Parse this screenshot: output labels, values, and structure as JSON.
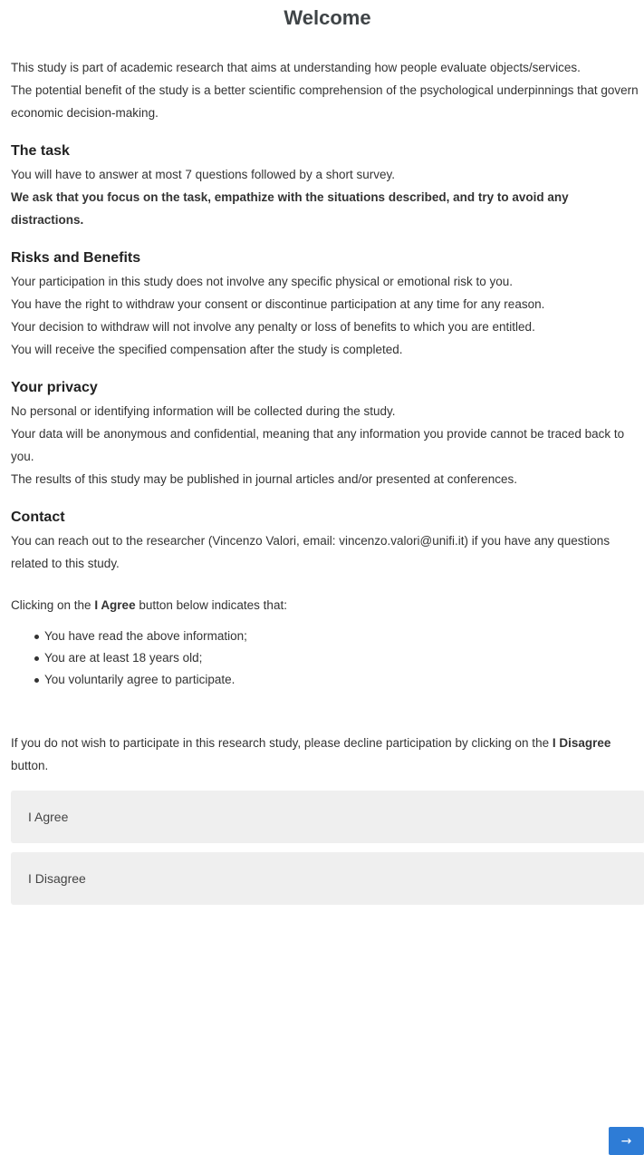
{
  "title": "Welcome",
  "intro": {
    "line1": "This study is part of academic research that aims at understanding how people evaluate objects/services.",
    "line2": "The potential benefit of the study is a better scientific comprehension of the psychological underpinnings that govern economic decision-making."
  },
  "task": {
    "heading": "The task",
    "line1": "You will have to answer at most 7 questions followed by a short survey.",
    "line2_bold": "We ask that you focus on the task, empathize with the situations described, and try to avoid any distractions."
  },
  "risks": {
    "heading": "Risks and Benefits",
    "lines": [
      "Your participation in this study does not involve any specific physical or emotional risk to you.",
      "You have the right to withdraw your consent or discontinue participation at any time for any reason.",
      "Your decision to withdraw will not involve any penalty or loss of benefits to which you are entitled.",
      "You will receive the specified compensation after the study is completed."
    ]
  },
  "privacy": {
    "heading": "Your privacy",
    "lines": [
      "No personal or identifying information will be collected during the study.",
      "Your data will be anonymous and confidential, meaning that any information you provide cannot be traced back to you.",
      "The results of this study may be published in journal articles and/or presented at conferences."
    ]
  },
  "contact": {
    "heading": "Contact",
    "text": "You can reach out to the researcher (Vincenzo Valori, email: vincenzo.valori@unifi.it) if you have any questions related to this study."
  },
  "consent": {
    "clicking_prefix": "Clicking on the ",
    "clicking_bold": "I Agree",
    "clicking_suffix": " button below indicates that:",
    "conditions": [
      "You have read the above information;",
      "You are at least 18 years old;",
      "You voluntarily agree to participate."
    ],
    "decline_prefix": "If you do not wish to participate in this research study, please decline participation by clicking on the ",
    "decline_bold": "I Disagree",
    "decline_suffix": " button."
  },
  "choices": {
    "agree": "I Agree",
    "disagree": "I Disagree"
  },
  "next_button": {
    "label": "→",
    "icon": "arrow-right-icon",
    "color": "#2e7cd6"
  }
}
